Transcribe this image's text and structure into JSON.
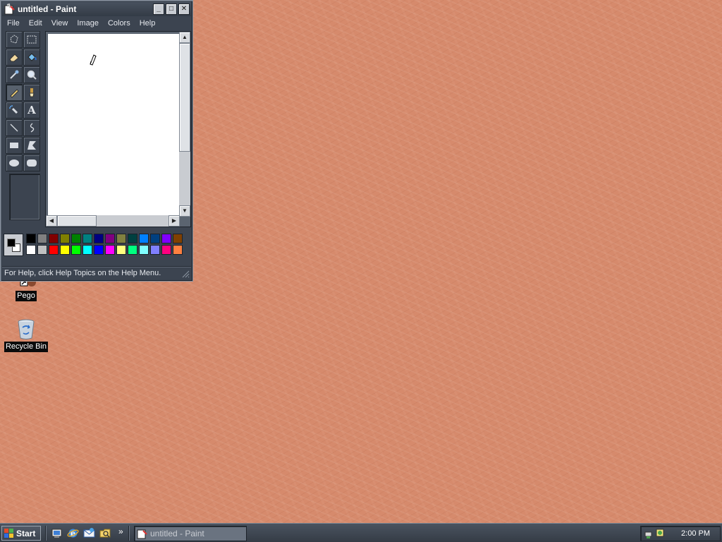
{
  "window": {
    "title": "untitled - Paint",
    "controls": {
      "minimize": "_",
      "maximize": "□",
      "close": "✕"
    }
  },
  "menu": [
    "File",
    "Edit",
    "View",
    "Image",
    "Colors",
    "Help"
  ],
  "tools": [
    "free-select-icon",
    "rect-select-icon",
    "eraser-icon",
    "fill-icon",
    "color-picker-icon",
    "magnifier-icon",
    "pencil-icon",
    "brush-icon",
    "airbrush-icon",
    "text-icon",
    "line-icon",
    "curve-icon",
    "rectangle-icon",
    "polygon-icon",
    "ellipse-icon",
    "rounded-rect-icon"
  ],
  "text_tool_glyph": "A",
  "active_tool": "pencil-icon",
  "palette": {
    "foreground": "#000000",
    "background": "#ffffff",
    "row1": [
      "#000000",
      "#808080",
      "#800000",
      "#808000",
      "#008000",
      "#008080",
      "#000080",
      "#800080",
      "#808040",
      "#004040",
      "#0080ff",
      "#004080",
      "#8000ff",
      "#804000"
    ],
    "row2": [
      "#ffffff",
      "#c0c0c0",
      "#ff0000",
      "#ffff00",
      "#00ff00",
      "#00ffff",
      "#0000ff",
      "#ff00ff",
      "#ffff80",
      "#00ff80",
      "#80ffff",
      "#8080ff",
      "#ff0080",
      "#ff8040"
    ]
  },
  "status": "For Help, click Help Topics on the Help Menu.",
  "desktop_icons": [
    {
      "label": "Pego",
      "icon": "shortcut-icon"
    },
    {
      "label": "Recycle Bin",
      "icon": "recycle-bin-icon"
    }
  ],
  "taskbar": {
    "start_label": "Start",
    "quicklaunch": [
      "show-desktop-icon",
      "internet-explorer-icon",
      "outlook-express-icon",
      "windows-explorer-icon"
    ],
    "chevron": "»",
    "task_label": "untitled - Paint",
    "clock": "2:00 PM"
  }
}
